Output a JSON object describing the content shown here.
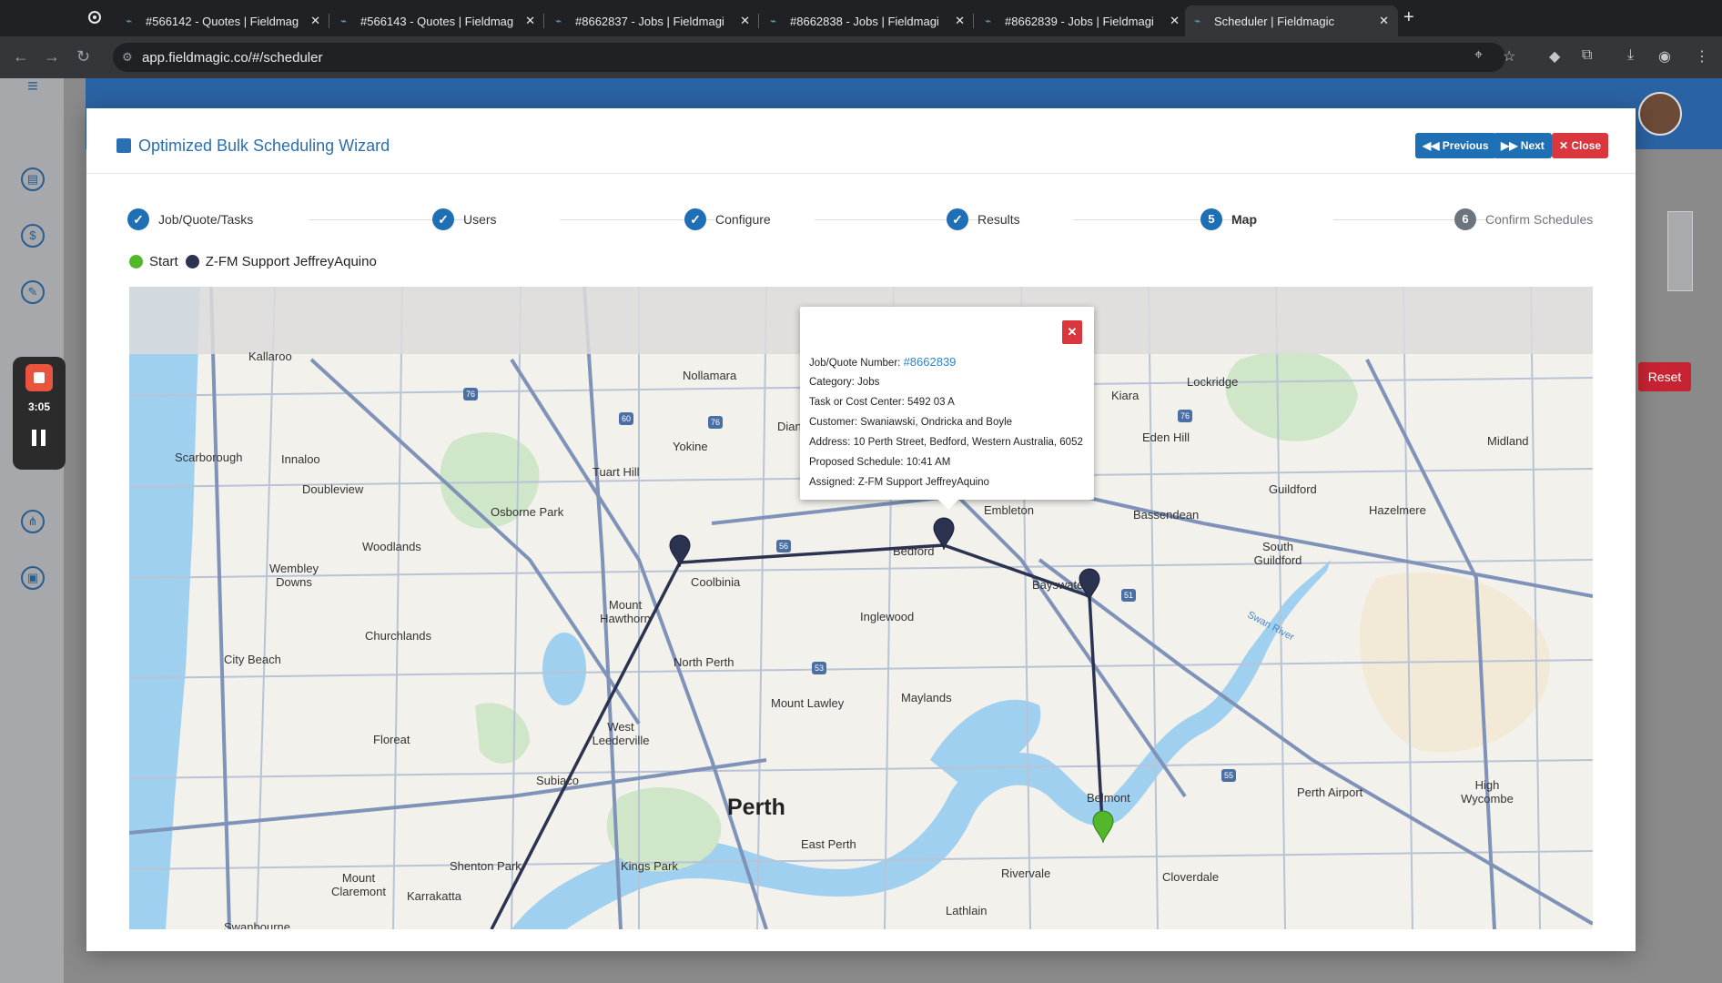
{
  "browser": {
    "tabs": [
      {
        "title": "#566142 - Quotes | Fieldmag"
      },
      {
        "title": "#566143 - Quotes | Fieldmag"
      },
      {
        "title": "#8662837 - Jobs | Fieldmagi"
      },
      {
        "title": "#8662838 - Jobs | Fieldmagi"
      },
      {
        "title": "#8662839 - Jobs | Fieldmagi"
      },
      {
        "title": "Scheduler | Fieldmagic",
        "active": true
      }
    ],
    "url": "app.fieldmagic.co/#/scheduler"
  },
  "recorder": {
    "time": "3:05"
  },
  "background": {
    "reset_label": "Reset"
  },
  "modal": {
    "title": "Optimized Bulk Scheduling Wizard",
    "buttons": {
      "previous": "Previous",
      "next": "Next",
      "close": "Close"
    },
    "steps": [
      {
        "label": "Job/Quote/Tasks",
        "state": "done"
      },
      {
        "label": "Users",
        "state": "done"
      },
      {
        "label": "Configure",
        "state": "done"
      },
      {
        "label": "Results",
        "state": "done"
      },
      {
        "number": "5",
        "label": "Map",
        "state": "current"
      },
      {
        "number": "6",
        "label": "Confirm Schedules",
        "state": "pending"
      }
    ],
    "legend": [
      {
        "label": "Start",
        "color": "#52b82a"
      },
      {
        "label": "Z-FM Support JeffreyAquino",
        "color": "#2b3350"
      }
    ]
  },
  "map": {
    "route_color": "#2b3350",
    "start_color": "#52b82a",
    "labels": {
      "perth": "Perth",
      "nollamara": "Nollamara",
      "yokine": "Yokine",
      "innaloo": "Innaloo",
      "scarborough": "Scarborough",
      "doubleview": "Doubleview",
      "tuart_hill": "Tuart Hill",
      "osborne_park": "Osborne Park",
      "woodlands": "Woodlands",
      "wembley_downs": "Wembley Downs",
      "churchlands": "Churchlands",
      "city_beach": "City Beach",
      "floreat": "Floreat",
      "subiaco": "Subiaco",
      "west_leederville": "West Leederville",
      "north_perth": "North Perth",
      "mount_hawthorn": "Mount Hawthorn",
      "coolbinia": "Coolbinia",
      "inglewood": "Inglewood",
      "mount_lawley": "Mount Lawley",
      "maylands": "Maylands",
      "bedford": "Bedford",
      "embleton": "Embleton",
      "bayswater": "Bayswater",
      "kiara": "Kiara",
      "lockridge": "Lockridge",
      "eden_hill": "Eden Hill",
      "bassendean": "Bassendean",
      "guildford": "Guildford",
      "hazelmere": "Hazelmere",
      "south_guildford": "South Guildford",
      "midland": "Midland",
      "belmont": "Belmont",
      "perth_airport": "Perth Airport",
      "high_wycombe": "High Wycombe",
      "cloverdale": "Cloverdale",
      "rivervale": "Rivervale",
      "lathlain": "Lathlain",
      "east_perth": "East Perth",
      "kings_park": "Kings Park",
      "shenton_park": "Shenton Park",
      "karrakatta": "Karrakatta",
      "mount_claremont": "Mount Claremont",
      "swanbourne": "Swanbourne",
      "kallaroo": "Kallaroo",
      "dianella": "Dian",
      "swan_river": "Swan River"
    },
    "popup": {
      "job_label": "Job/Quote Number:",
      "job_number": "#8662839",
      "category": "Category: Jobs",
      "cost_center": "Task or Cost Center: 5492 03 A",
      "customer": "Customer: Swaniawski, Ondricka and Boyle",
      "address": "Address: 10 Perth Street, Bedford, Western Australia, 6052",
      "schedule": "Proposed Schedule: 10:41 AM",
      "assigned": "Assigned: Z-FM Support JeffreyAquino"
    }
  }
}
